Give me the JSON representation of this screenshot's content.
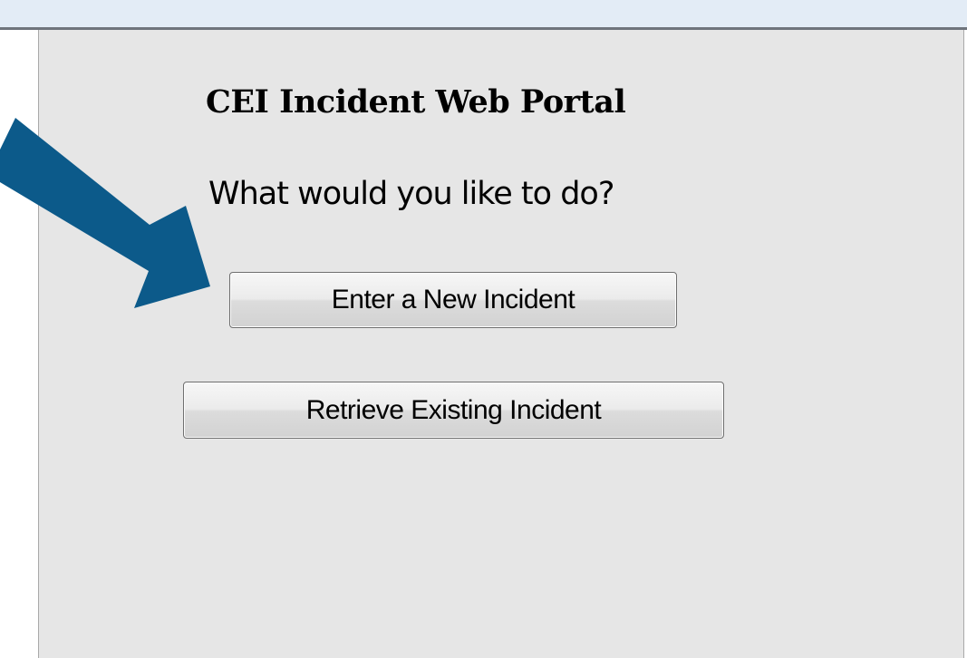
{
  "portal": {
    "title": "CEI Incident Web Portal",
    "prompt": "What would you like to do?"
  },
  "actions": {
    "new_incident_label": "Enter a New Incident",
    "retrieve_incident_label": "Retrieve Existing Incident"
  },
  "annotation": {
    "arrow_icon": "pointer-arrow-icon",
    "arrow_color": "#0c5a8a"
  },
  "colors": {
    "panel_background": "#e6e6e6",
    "topbar_background": "#e3ecf6"
  }
}
